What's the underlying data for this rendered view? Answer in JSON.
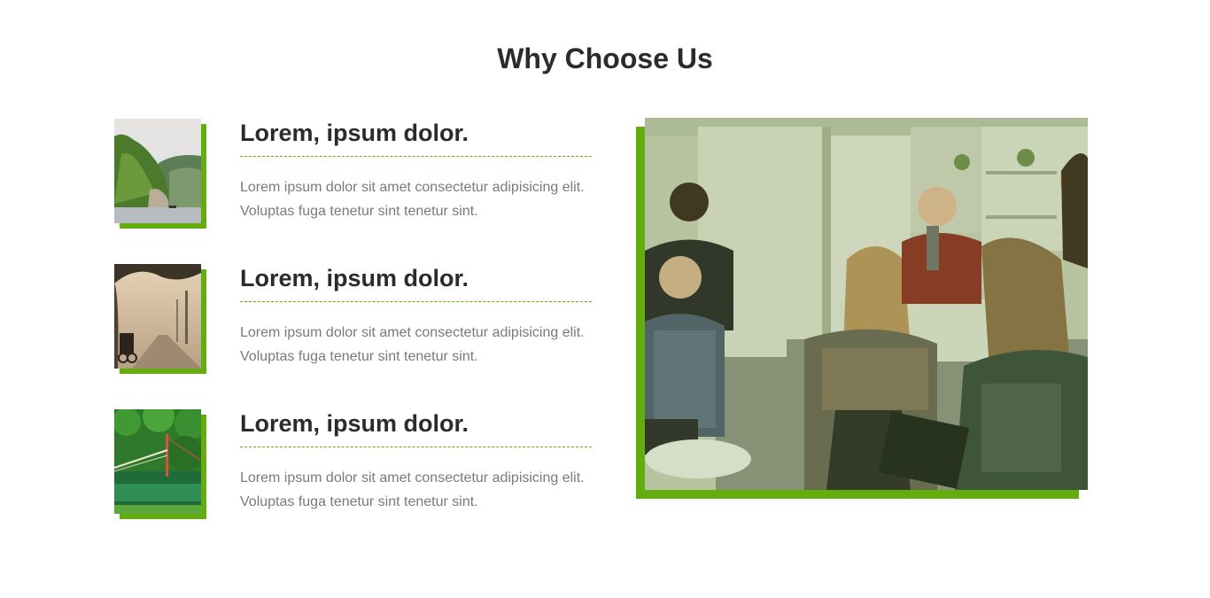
{
  "section": {
    "title": "Why Choose Us"
  },
  "features": [
    {
      "heading": "Lorem, ipsum dolor.",
      "text": "Lorem ipsum dolor sit amet consectetur adipisicing elit. Voluptas fuga tenetur sint tenetur sint.",
      "image": "coastal-cliff-photo"
    },
    {
      "heading": "Lorem, ipsum dolor.",
      "text": "Lorem ipsum dolor sit amet consectetur adipisicing elit. Voluptas fuga tenetur sint tenetur sint.",
      "image": "misty-road-photo"
    },
    {
      "heading": "Lorem, ipsum dolor.",
      "text": "Lorem ipsum dolor sit amet consectetur adipisicing elit. Voluptas fuga tenetur sint tenetur sint.",
      "image": "suspension-bridge-photo"
    }
  ],
  "hero_image": "team-meeting-photo",
  "colors": {
    "accent": "#63ad0e",
    "heading": "#2b2b2b",
    "body_text": "#7a7a7a"
  }
}
